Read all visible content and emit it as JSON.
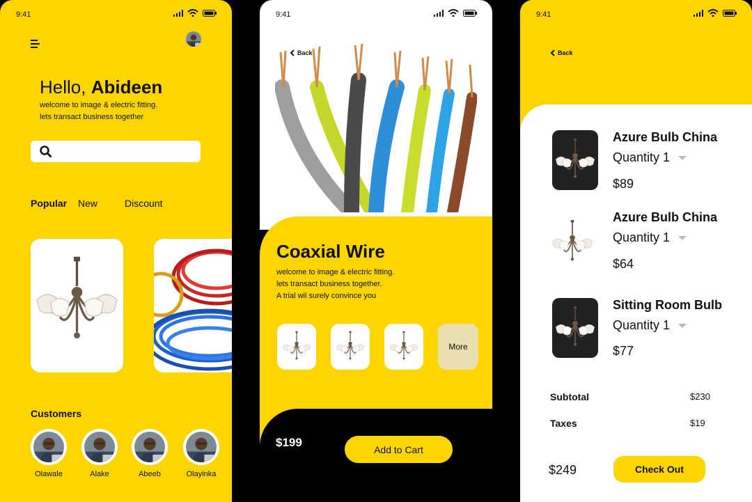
{
  "status": {
    "time": "9:41"
  },
  "home": {
    "greeting_prefix": "Hello,",
    "greeting_name": "Abideen",
    "welcome_line1": "welcome to image & electric fitting.",
    "welcome_line2": "lets transact business together",
    "search_placeholder": "",
    "tabs": [
      "Popular",
      "New",
      "Discount"
    ],
    "customers_title": "Customers",
    "customers": [
      "Olawale",
      "Alake",
      "Abeeb",
      "Olayinka"
    ]
  },
  "product": {
    "back_label": "Back",
    "title": "Coaxial Wire",
    "desc_line1": "welcome to image & electric fitting.",
    "desc_line2": "lets transact business together.",
    "desc_line3": "A trial wil surely convince you",
    "more_label": "More",
    "price": "$199",
    "add_to_cart_label": "Add to Cart"
  },
  "cart": {
    "back_label": "Back",
    "items": [
      {
        "title": "Azure Bulb China",
        "qty": "Quantity 1",
        "price": "$89"
      },
      {
        "title": "Azure Bulb China",
        "qty": "Quantity 1",
        "price": "$64"
      },
      {
        "title": "Sitting Room Bulb",
        "qty": "Quantity 1",
        "price": "$77"
      }
    ],
    "subtotal_label": "Subtotal",
    "subtotal_value": "$230",
    "taxes_label": "Taxes",
    "taxes_value": "$19",
    "total": "$249",
    "checkout_label": "Check Out"
  },
  "colors": {
    "accent": "#FFD500",
    "dark": "#000000",
    "card": "#FFFFFF",
    "more_bg": "#E9DFAE"
  },
  "icons": [
    "menu-icon",
    "avatar",
    "search-icon",
    "signal-icon",
    "wifi-icon",
    "battery-icon",
    "back-chevron-icon",
    "dropdown-caret-icon",
    "chandelier-image",
    "wire-image",
    "customer-photo"
  ]
}
